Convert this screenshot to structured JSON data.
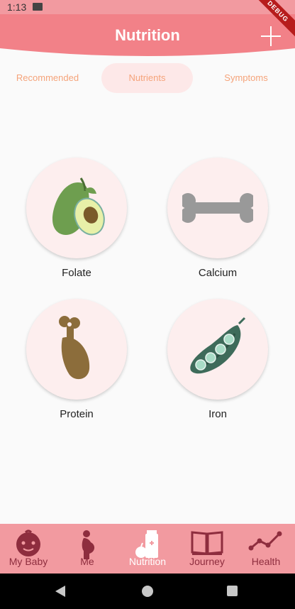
{
  "status_bar": {
    "time": "1:13",
    "debug_label": "DEBUG"
  },
  "app_bar": {
    "title": "Nutrition"
  },
  "tabs": [
    {
      "label": "Recommended",
      "active": false
    },
    {
      "label": "Nutrients",
      "active": true
    },
    {
      "label": "Symptoms",
      "active": false
    }
  ],
  "nutrients": [
    {
      "label": "Folate",
      "icon": "avocado-icon"
    },
    {
      "label": "Calcium",
      "icon": "bone-icon"
    },
    {
      "label": "Protein",
      "icon": "drumstick-icon"
    },
    {
      "label": "Iron",
      "icon": "peapod-icon"
    }
  ],
  "bottom_nav": [
    {
      "label": "My Baby",
      "icon": "baby-face-icon",
      "active": false
    },
    {
      "label": "Me",
      "icon": "pregnant-woman-icon",
      "active": false
    },
    {
      "label": "Nutrition",
      "icon": "nutrition-icon",
      "active": true
    },
    {
      "label": "Journey",
      "icon": "book-icon",
      "active": false
    },
    {
      "label": "Health",
      "icon": "chart-line-icon",
      "active": false
    }
  ],
  "colors": {
    "primary": "#f28188",
    "tab_text": "#f5a37a",
    "nav_bg": "#f29aa0",
    "nav_inactive": "#8e2d3e",
    "circle_bg": "#fdeeee"
  }
}
